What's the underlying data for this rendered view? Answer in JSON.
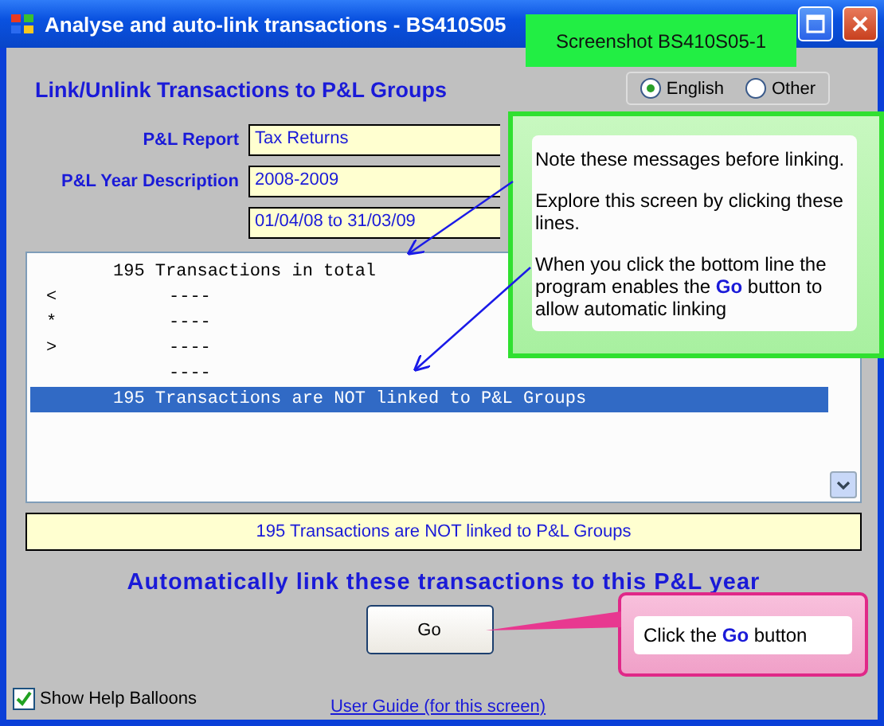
{
  "window": {
    "title": "Analyse and auto-link transactions - BS410S05"
  },
  "screenshot_tag": "Screenshot BS410S05-1",
  "header": {
    "title": "Link/Unlink Transactions to P&L Groups"
  },
  "languages": [
    {
      "label": "English",
      "selected": true
    },
    {
      "label": "Other",
      "selected": false
    }
  ],
  "fields": [
    {
      "label": "P&L Report",
      "value": "Tax Returns"
    },
    {
      "label": "P&L Year Description",
      "value": "2008-2009"
    },
    {
      "value": "01/04/08 to 31/03/09"
    }
  ],
  "list_rows": [
    {
      "kind": "summary",
      "text": "195 Transactions in total",
      "selected": false
    },
    {
      "kind": "detail",
      "marker": "<",
      "text": "----",
      "selected": false
    },
    {
      "kind": "detail",
      "marker": "*",
      "text": "----",
      "selected": false
    },
    {
      "kind": "detail",
      "marker": ">",
      "text": "----",
      "selected": false
    },
    {
      "kind": "detail",
      "text": "----",
      "selected": false
    },
    {
      "kind": "summary",
      "text": "195 Transactions are NOT linked to P&L Groups",
      "selected": true
    }
  ],
  "status": "195 Transactions are NOT linked to P&L Groups",
  "action_heading": "Automatically link these transactions to this P&L year",
  "go_button": "Go",
  "show_help": {
    "label": "Show Help Balloons",
    "checked": true
  },
  "guide_link": "User Guide (for this screen)",
  "note_callout": [
    "Note these messages before linking.",
    "Explore this screen by clicking these lines.",
    "When you click the bottom line the program enables the **Go** button to allow automatic linking"
  ],
  "click_callout": "Click the **Go** button"
}
